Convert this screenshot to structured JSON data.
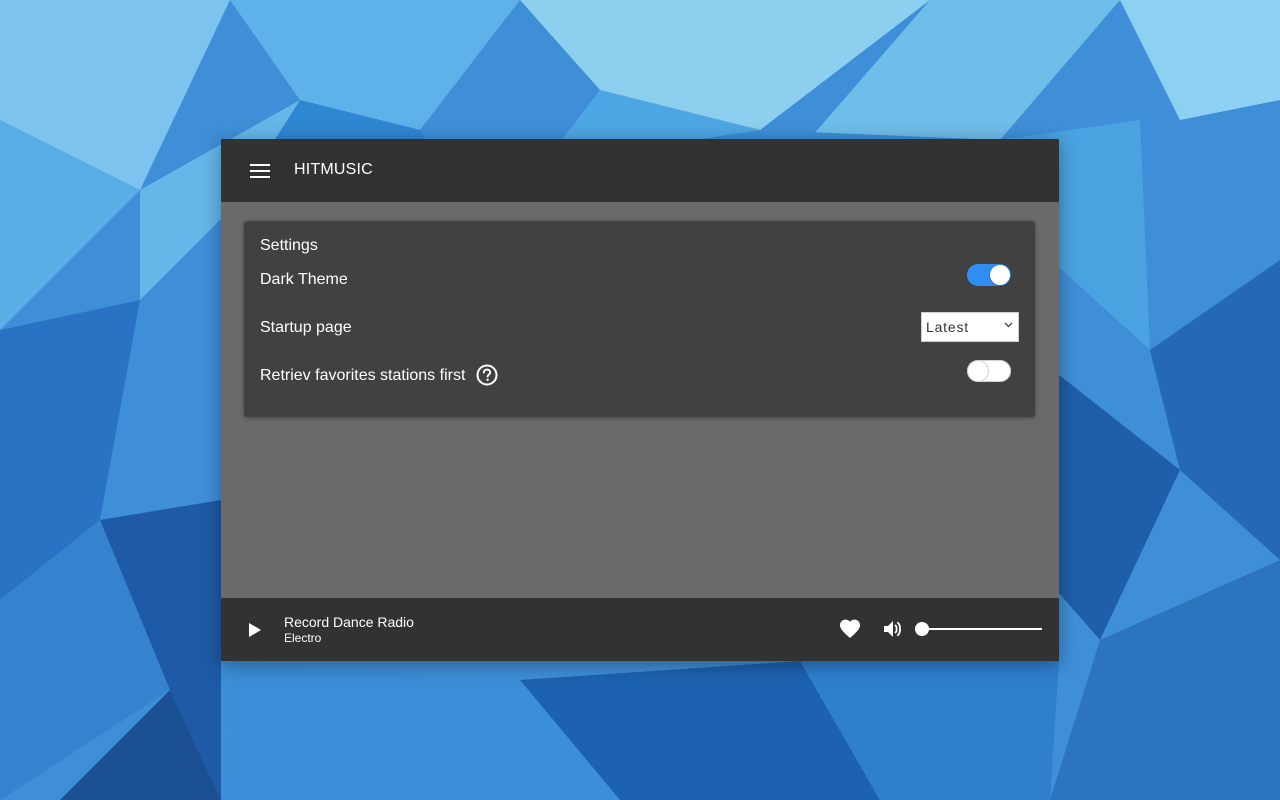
{
  "app": {
    "title": "HITMUSIC",
    "menu_icon": "hamburger-menu-icon"
  },
  "settings": {
    "title": "Settings",
    "dark_theme": {
      "label": "Dark Theme",
      "enabled": true
    },
    "startup_page": {
      "label": "Startup page",
      "selected": "Latest"
    },
    "retrieve_favorites": {
      "label": "Retriev favorites stations first",
      "enabled": false,
      "help_icon": "help-circle-icon"
    }
  },
  "player": {
    "station_name": "Record Dance Radio",
    "genre": "Electro",
    "play_icon": "play-icon",
    "favorite_icon": "heart-icon",
    "volume_icon": "volume-icon",
    "volume_level": 0
  },
  "colors": {
    "header_bg": "#323232",
    "content_bg": "#6a6a6a",
    "card_bg": "#414141",
    "accent": "#2f8ef0"
  }
}
